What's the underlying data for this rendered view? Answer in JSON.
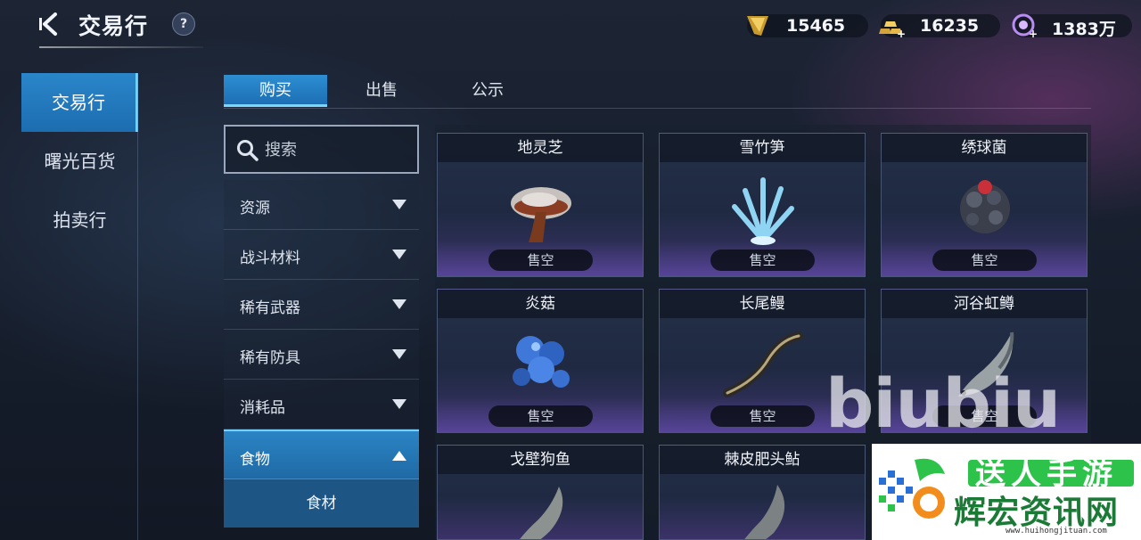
{
  "header": {
    "title": "交易行",
    "help_label": "?",
    "currencies": [
      {
        "icon": "gold-crystal-icon",
        "value": "15465"
      },
      {
        "icon": "gold-bars-icon",
        "value": "16235"
      },
      {
        "icon": "purple-orb-icon",
        "value": "1383万"
      }
    ]
  },
  "left_nav": {
    "items": [
      {
        "label": "交易行",
        "active": true
      },
      {
        "label": "曙光百货",
        "active": false
      },
      {
        "label": "拍卖行",
        "active": false
      }
    ]
  },
  "tabs": [
    {
      "label": "购买",
      "active": true
    },
    {
      "label": "出售",
      "active": false
    },
    {
      "label": "公示",
      "active": false
    }
  ],
  "search": {
    "placeholder": "搜索",
    "value": ""
  },
  "categories": [
    {
      "label": "资源",
      "expanded": false
    },
    {
      "label": "战斗材料",
      "expanded": false
    },
    {
      "label": "稀有武器",
      "expanded": false
    },
    {
      "label": "稀有防具",
      "expanded": false
    },
    {
      "label": "消耗品",
      "expanded": false
    },
    {
      "label": "食物",
      "expanded": true
    }
  ],
  "subcategory": {
    "label": "食材"
  },
  "items": [
    {
      "name": "地灵芝",
      "status": "售空",
      "icon": "mushroom-icon"
    },
    {
      "name": "雪竹笋",
      "status": "售空",
      "icon": "ice-bamboo-icon"
    },
    {
      "name": "绣球菌",
      "status": "售空",
      "icon": "hydrangea-fungus-icon"
    },
    {
      "name": "炎菇",
      "status": "售空",
      "icon": "blue-mushroom-cluster-icon"
    },
    {
      "name": "长尾鳗",
      "status": "售空",
      "icon": "eel-icon"
    },
    {
      "name": "河谷虹鳟",
      "status": "售空",
      "icon": "trout-icon"
    },
    {
      "name": "戈壁狗鱼",
      "status": "",
      "icon": "pike-fish-icon"
    },
    {
      "name": "棘皮肥头鲇",
      "status": "",
      "icon": "catfish-icon"
    }
  ],
  "watermarks": {
    "overlay_text": "biubiu",
    "logo_banner": "送人手游",
    "logo_main": "辉宏资讯网",
    "logo_url": "www.huihongjituan.com"
  },
  "colors": {
    "accent": "#2a86c9",
    "accent_light": "#74d0ff",
    "card_bottom": "#3b3268"
  }
}
